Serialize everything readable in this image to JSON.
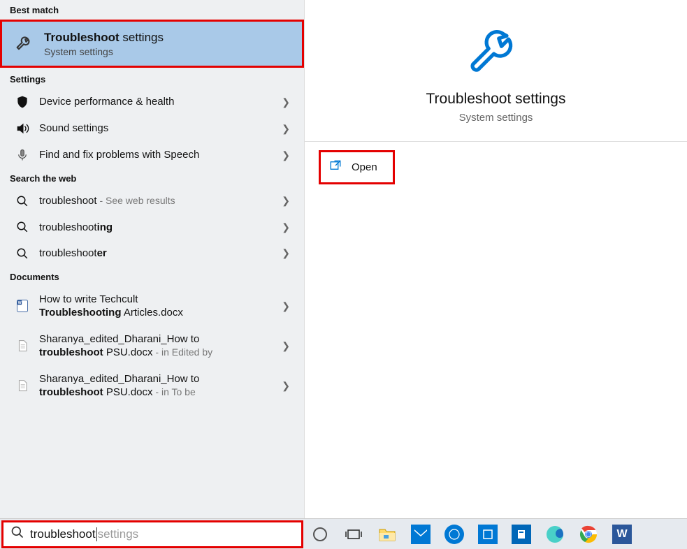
{
  "sections": {
    "best_match": "Best match",
    "settings": "Settings",
    "search_web": "Search the web",
    "documents": "Documents"
  },
  "best_match": {
    "title_bold": "Troubleshoot",
    "title_rest": " settings",
    "subtitle": "System settings"
  },
  "settings_items": [
    {
      "label": "Device performance & health"
    },
    {
      "label": "Sound settings"
    },
    {
      "label": "Find and fix problems with Speech"
    }
  ],
  "web_items": [
    {
      "prefix": "troubleshoot",
      "suffix": "",
      "note": " - See web results"
    },
    {
      "prefix": "troubleshoot",
      "suffix": "ing",
      "note": ""
    },
    {
      "prefix": "troubleshoot",
      "suffix": "er",
      "note": ""
    }
  ],
  "doc_items": [
    {
      "line1_pre": "How to write Techcult",
      "line1_suf": "",
      "line2_bold": "Troubleshooting",
      "line2_rest": " Articles.docx",
      "note": ""
    },
    {
      "line1_pre": "Sharanya_edited_Dharani_How to",
      "line1_suf": "",
      "line2_bold": "troubleshoot",
      "line2_rest": " PSU.docx",
      "note": " - in Edited by"
    },
    {
      "line1_pre": "Sharanya_edited_Dharani_How to",
      "line1_suf": "",
      "line2_bold": "troubleshoot",
      "line2_rest": " PSU.docx",
      "note": " - in To be"
    }
  ],
  "hero": {
    "title": "Troubleshoot settings",
    "subtitle": "System settings",
    "open": "Open"
  },
  "search": {
    "typed": "troubleshoot",
    "ghost": " settings"
  }
}
